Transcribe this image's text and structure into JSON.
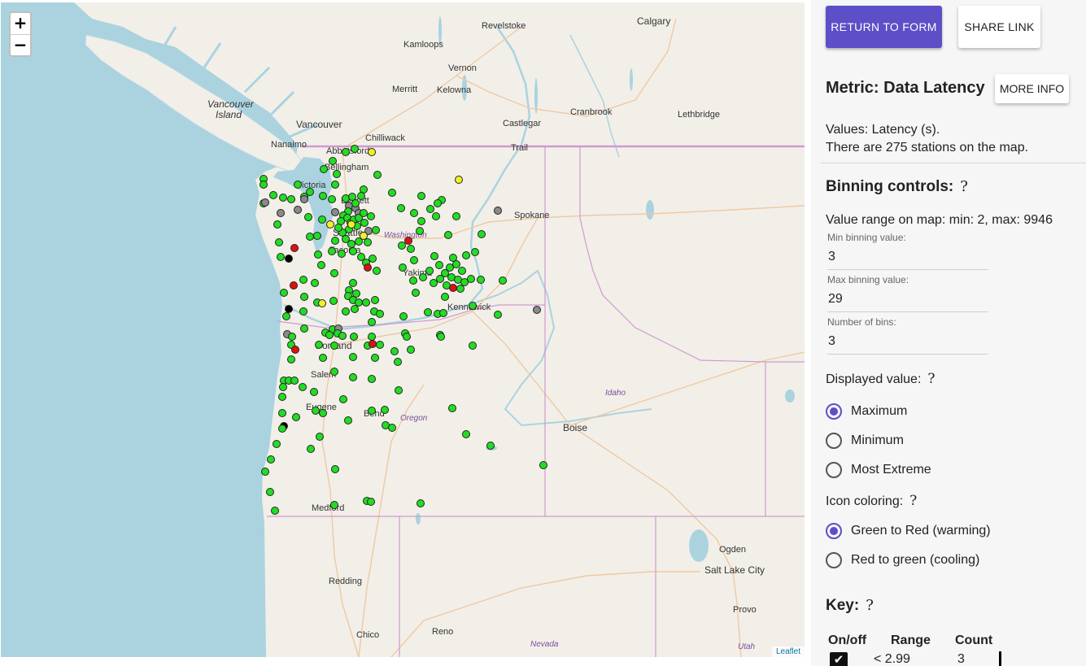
{
  "map": {
    "zoom_in": "+",
    "zoom_out": "−",
    "attribution": "Leaflet",
    "colors": {
      "water": "#aad3df",
      "land": "#f2efe9",
      "border": "#cf9acf",
      "road": "#f0c9a0",
      "green": "#22dd22",
      "yellow": "#f0f028",
      "red": "#e01010",
      "grey": "#8a8a8a",
      "black": "#000000"
    },
    "labels": {
      "calgary": "Calgary",
      "revelstoke": "Revelstoke",
      "kamloops": "Kamloops",
      "vernon": "Vernon",
      "merritt": "Merritt",
      "kelowna": "Kelowna",
      "vancouver_island": "Vancouver",
      "vancouver_island_2": "Island",
      "vancouver": "Vancouver",
      "cranbrook": "Cranbrook",
      "lethbridge": "Lethbridge",
      "castlegar": "Castlegar",
      "chilliwack": "Chilliwack",
      "trail": "Trail",
      "nanaimo": "Nanaimo",
      "abbotsford": "Abbotsford",
      "bellingham": "Bellingham",
      "victoria": "Victoria",
      "everett": "Everett",
      "spokane": "Spokane",
      "seattle": "Seattle",
      "washington": "Washington",
      "tacoma": "Tacoma",
      "yakima": "Yakima",
      "kennewick": "Kennewick",
      "portland": "Portland",
      "salem": "Salem",
      "idaho": "Idaho",
      "eugene": "Eugene",
      "bend": "Bend",
      "oregon": "Oregon",
      "boise": "Boise",
      "medford": "Medford",
      "ogden": "Ogden",
      "salt_lake_city": "Salt Lake City",
      "redding": "Redding",
      "provo": "Provo",
      "chico": "Chico",
      "reno": "Reno",
      "nevada": "Nevada",
      "utah": "Utah"
    },
    "stations": [
      [
        456,
        187,
        "y"
      ],
      [
        563,
        221,
        "y"
      ],
      [
        435,
        183,
        "g"
      ],
      [
        424,
        187,
        "g"
      ],
      [
        408,
        198,
        "g"
      ],
      [
        397,
        208,
        "g"
      ],
      [
        413,
        214,
        "g"
      ],
      [
        463,
        215,
        "g"
      ],
      [
        323,
        220,
        "g"
      ],
      [
        365,
        227,
        "g"
      ],
      [
        411,
        227,
        "g"
      ],
      [
        446,
        233,
        "g"
      ],
      [
        380,
        236,
        "g"
      ],
      [
        323,
        227,
        "g"
      ],
      [
        323,
        250,
        "g"
      ],
      [
        335,
        240,
        "g"
      ],
      [
        347,
        243,
        "g"
      ],
      [
        357,
        245,
        "g"
      ],
      [
        373,
        242,
        "g"
      ],
      [
        396,
        241,
        "g"
      ],
      [
        407,
        245,
        "g"
      ],
      [
        424,
        244,
        "g"
      ],
      [
        432,
        242,
        "g"
      ],
      [
        443,
        241,
        "g"
      ],
      [
        481,
        237,
        "g"
      ],
      [
        517,
        241,
        "g"
      ],
      [
        542,
        246,
        "g"
      ],
      [
        537,
        250,
        "g"
      ],
      [
        492,
        256,
        "g"
      ],
      [
        528,
        257,
        "g"
      ],
      [
        508,
        262,
        "g"
      ],
      [
        535,
        266,
        "g"
      ],
      [
        560,
        266,
        "g"
      ],
      [
        517,
        272,
        "g"
      ],
      [
        611,
        259,
        "x"
      ],
      [
        325,
        249,
        "x"
      ],
      [
        344,
        262,
        "x"
      ],
      [
        365,
        258,
        "x"
      ],
      [
        373,
        245,
        "x"
      ],
      [
        411,
        261,
        "x"
      ],
      [
        428,
        253,
        "x"
      ],
      [
        436,
        256,
        "x"
      ],
      [
        440,
        262,
        "x"
      ],
      [
        452,
        284,
        "x"
      ],
      [
        436,
        250,
        "g"
      ],
      [
        427,
        260,
        "g"
      ],
      [
        421,
        265,
        "g"
      ],
      [
        418,
        272,
        "g"
      ],
      [
        426,
        268,
        "g"
      ],
      [
        430,
        274,
        "g"
      ],
      [
        434,
        270,
        "g"
      ],
      [
        440,
        268,
        "g"
      ],
      [
        446,
        262,
        "g"
      ],
      [
        455,
        266,
        "g"
      ],
      [
        447,
        274,
        "g"
      ],
      [
        438,
        278,
        "g"
      ],
      [
        428,
        282,
        "g"
      ],
      [
        420,
        286,
        "g"
      ],
      [
        405,
        276,
        "y"
      ],
      [
        431,
        276,
        "y"
      ],
      [
        446,
        290,
        "y"
      ],
      [
        415,
        280,
        "g"
      ],
      [
        395,
        270,
        "g"
      ],
      [
        378,
        267,
        "g"
      ],
      [
        411,
        296,
        "g"
      ],
      [
        424,
        294,
        "g"
      ],
      [
        431,
        300,
        "g"
      ],
      [
        440,
        297,
        "g"
      ],
      [
        451,
        298,
        "g"
      ],
      [
        461,
        283,
        "g"
      ],
      [
        501,
        296,
        "r"
      ],
      [
        493,
        302,
        "g"
      ],
      [
        504,
        306,
        "g"
      ],
      [
        515,
        284,
        "g"
      ],
      [
        550,
        289,
        "g"
      ],
      [
        591,
        288,
        "g"
      ],
      [
        340,
        276,
        "g"
      ],
      [
        342,
        298,
        "g"
      ],
      [
        380,
        291,
        "g"
      ],
      [
        389,
        290,
        "g"
      ],
      [
        354,
        318,
        "b"
      ],
      [
        361,
        305,
        "r"
      ],
      [
        344,
        316,
        "g"
      ],
      [
        390,
        313,
        "g"
      ],
      [
        407,
        309,
        "g"
      ],
      [
        419,
        312,
        "g"
      ],
      [
        433,
        309,
        "g"
      ],
      [
        443,
        316,
        "g"
      ],
      [
        449,
        323,
        "g"
      ],
      [
        457,
        318,
        "g"
      ],
      [
        451,
        329,
        "r"
      ],
      [
        462,
        333,
        "g"
      ],
      [
        394,
        326,
        "g"
      ],
      [
        410,
        336,
        "g"
      ],
      [
        372,
        344,
        "g"
      ],
      [
        386,
        348,
        "g"
      ],
      [
        360,
        351,
        "r"
      ],
      [
        494,
        329,
        "g"
      ],
      [
        508,
        320,
        "g"
      ],
      [
        533,
        315,
        "g"
      ],
      [
        556,
        317,
        "g"
      ],
      [
        572,
        314,
        "g"
      ],
      [
        583,
        310,
        "g"
      ],
      [
        539,
        326,
        "g"
      ],
      [
        552,
        329,
        "g"
      ],
      [
        560,
        325,
        "g"
      ],
      [
        567,
        333,
        "g"
      ],
      [
        546,
        336,
        "g"
      ],
      [
        554,
        341,
        "g"
      ],
      [
        562,
        344,
        "g"
      ],
      [
        570,
        347,
        "g"
      ],
      [
        578,
        343,
        "g"
      ],
      [
        590,
        344,
        "g"
      ],
      [
        540,
        343,
        "g"
      ],
      [
        532,
        348,
        "g"
      ],
      [
        548,
        351,
        "g"
      ],
      [
        556,
        354,
        "r"
      ],
      [
        565,
        355,
        "g"
      ],
      [
        617,
        345,
        "g"
      ],
      [
        519,
        341,
        "g"
      ],
      [
        507,
        345,
        "g"
      ],
      [
        510,
        360,
        "g"
      ],
      [
        546,
        365,
        "g"
      ],
      [
        527,
        333,
        "g"
      ],
      [
        433,
        348,
        "g"
      ],
      [
        428,
        357,
        "g"
      ],
      [
        437,
        361,
        "g"
      ],
      [
        427,
        364,
        "g"
      ],
      [
        433,
        369,
        "g"
      ],
      [
        440,
        372,
        "g"
      ],
      [
        449,
        372,
        "g"
      ],
      [
        460,
        369,
        "g"
      ],
      [
        348,
        360,
        "g"
      ],
      [
        373,
        365,
        "g"
      ],
      [
        389,
        372,
        "g"
      ],
      [
        409,
        370,
        "g"
      ],
      [
        395,
        373,
        "y"
      ],
      [
        354,
        380,
        "b"
      ],
      [
        372,
        383,
        "g"
      ],
      [
        424,
        383,
        "g"
      ],
      [
        435,
        380,
        "g"
      ],
      [
        459,
        383,
        "g"
      ],
      [
        466,
        386,
        "g"
      ],
      [
        495,
        389,
        "g"
      ],
      [
        525,
        384,
        "g"
      ],
      [
        537,
        386,
        "g"
      ],
      [
        544,
        385,
        "g"
      ],
      [
        580,
        376,
        "g"
      ],
      [
        611,
        387,
        "g"
      ],
      [
        659,
        381,
        "x"
      ],
      [
        351,
        389,
        "g"
      ],
      [
        352,
        411,
        "x"
      ],
      [
        373,
        404,
        "g"
      ],
      [
        399,
        409,
        "g"
      ],
      [
        408,
        405,
        "g"
      ],
      [
        415,
        404,
        "x"
      ],
      [
        414,
        410,
        "g"
      ],
      [
        420,
        413,
        "g"
      ],
      [
        404,
        412,
        "g"
      ],
      [
        434,
        414,
        "g"
      ],
      [
        456,
        396,
        "g"
      ],
      [
        497,
        410,
        "g"
      ],
      [
        499,
        414,
        "g"
      ],
      [
        540,
        412,
        "g"
      ],
      [
        541,
        414,
        "g"
      ],
      [
        358,
        414,
        "g"
      ],
      [
        357,
        424,
        "g"
      ],
      [
        362,
        430,
        "r"
      ],
      [
        391,
        424,
        "g"
      ],
      [
        410,
        425,
        "g"
      ],
      [
        451,
        425,
        "g"
      ],
      [
        457,
        423,
        "r"
      ],
      [
        466,
        424,
        "g"
      ],
      [
        456,
        414,
        "g"
      ],
      [
        484,
        432,
        "g"
      ],
      [
        504,
        430,
        "g"
      ],
      [
        580,
        425,
        "g"
      ],
      [
        357,
        442,
        "g"
      ],
      [
        396,
        440,
        "g"
      ],
      [
        433,
        439,
        "g"
      ],
      [
        460,
        440,
        "g"
      ],
      [
        488,
        445,
        "g"
      ],
      [
        410,
        457,
        "g"
      ],
      [
        348,
        468,
        "g"
      ],
      [
        354,
        468,
        "g"
      ],
      [
        361,
        468,
        "g"
      ],
      [
        347,
        476,
        "g"
      ],
      [
        371,
        476,
        "g"
      ],
      [
        385,
        482,
        "g"
      ],
      [
        433,
        464,
        "g"
      ],
      [
        456,
        466,
        "g"
      ],
      [
        489,
        480,
        "g"
      ],
      [
        346,
        488,
        "g"
      ],
      [
        421,
        491,
        "g"
      ],
      [
        387,
        505,
        "g"
      ],
      [
        396,
        508,
        "g"
      ],
      [
        456,
        505,
        "g"
      ],
      [
        472,
        504,
        "g"
      ],
      [
        555,
        502,
        "g"
      ],
      [
        346,
        508,
        "g"
      ],
      [
        363,
        513,
        "g"
      ],
      [
        427,
        517,
        "g"
      ],
      [
        348,
        524,
        "b"
      ],
      [
        346,
        527,
        "g"
      ],
      [
        473,
        523,
        "g"
      ],
      [
        481,
        526,
        "g"
      ],
      [
        392,
        537,
        "g"
      ],
      [
        572,
        534,
        "g"
      ],
      [
        339,
        546,
        "g"
      ],
      [
        381,
        552,
        "g"
      ],
      [
        602,
        548,
        "g"
      ],
      [
        332,
        565,
        "g"
      ],
      [
        325,
        580,
        "g"
      ],
      [
        411,
        577,
        "g"
      ],
      [
        667,
        572,
        "g"
      ],
      [
        331,
        605,
        "g"
      ],
      [
        410,
        621,
        "g"
      ],
      [
        450,
        616,
        "g"
      ],
      [
        455,
        617,
        "g"
      ],
      [
        516,
        619,
        "g"
      ],
      [
        337,
        628,
        "g"
      ]
    ]
  },
  "panel": {
    "return_button": "RETURN TO FORM",
    "share_button": "SHARE LINK",
    "metric_title": "Metric: Data Latency",
    "more_info_button": "MORE INFO",
    "values_text": "Values: Latency (s).",
    "stations_text": "There are 275 stations on the map.",
    "binning_title": "Binning controls:",
    "help_glyph": "?",
    "value_range": "Value range on map: min: 2, max: 9946",
    "min_bin_label": "Min binning value:",
    "min_bin_value": "3",
    "max_bin_label": "Max binning value:",
    "max_bin_value": "29",
    "num_bins_label": "Number of bins:",
    "num_bins_value": "3",
    "displayed_title": "Displayed value:",
    "displayed_options": [
      "Maximum",
      "Minimum",
      "Most Extreme"
    ],
    "displayed_selected": "Maximum",
    "coloring_title": "Icon coloring:",
    "coloring_options": [
      "Green to Red (warming)",
      "Red to green (cooling)"
    ],
    "coloring_selected": "Green to Red (warming)",
    "key_title": "Key:",
    "key_headers": [
      "On/off",
      "Range",
      "Count"
    ],
    "key_rows": [
      {
        "checked": true,
        "range": "< 2.99",
        "count": "3"
      }
    ]
  }
}
